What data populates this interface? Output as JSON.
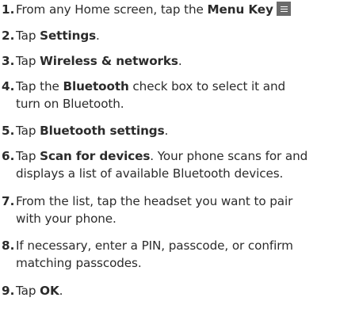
{
  "steps": [
    {
      "num": "1.",
      "a": "From any Home screen, tap the ",
      "b": "Menu Key"
    },
    {
      "num": "2.",
      "a": "Tap ",
      "b": "Settings",
      "c": "."
    },
    {
      "num": "3.",
      "a": "Tap ",
      "b": "Wireless & networks",
      "c": "."
    },
    {
      "num": "4.",
      "a": "Tap the ",
      "b": "Bluetooth",
      "c": " check box to select it and",
      "line2": "turn on Bluetooth."
    },
    {
      "num": "5.",
      "a": "Tap ",
      "b": "Bluetooth settings",
      "c": "."
    },
    {
      "num": "6.",
      "a": "Tap ",
      "b": "Scan for devices",
      "c": ". Your phone scans for and",
      "line2": "displays a list of available Bluetooth devices."
    },
    {
      "num": "7.",
      "a": "From the list, tap the headset you want to pair",
      "line2": "with your phone."
    },
    {
      "num": "8.",
      "a": "If necessary, enter a PIN, passcode, or confirm",
      "line2": "matching passcodes."
    },
    {
      "num": "9.",
      "a": "Tap ",
      "b": "OK",
      "c": "."
    }
  ],
  "icons": {
    "menu_key": "menu-key-icon"
  }
}
